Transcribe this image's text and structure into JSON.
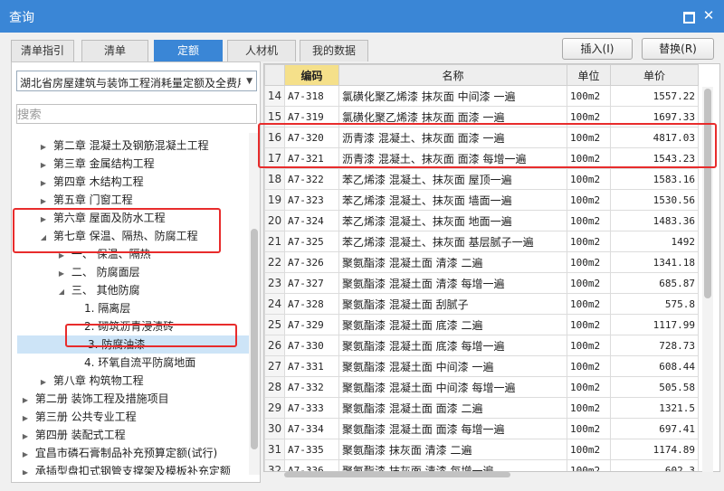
{
  "window": {
    "title": "查询"
  },
  "tabs": [
    {
      "label": "清单指引"
    },
    {
      "label": "清单"
    },
    {
      "label": "定额"
    },
    {
      "label": "人材机"
    },
    {
      "label": "我的数据"
    }
  ],
  "toolbar": {
    "insert_label": "插入(I)",
    "replace_label": "替换(R)"
  },
  "left": {
    "dropdown_value": "湖北省房屋建筑与装饰工程消耗量定额及全费用",
    "search_placeholder": "搜索",
    "tree": [
      {
        "label": "第二章 混凝土及钢筋混凝土工程",
        "expander": "▶"
      },
      {
        "label": "第三章 金属结构工程",
        "expander": "▶"
      },
      {
        "label": "第四章 木结构工程",
        "expander": "▶"
      },
      {
        "label": "第五章 门窗工程",
        "expander": "▶"
      },
      {
        "label": "第六章 屋面及防水工程",
        "expander": "▶"
      },
      {
        "label": "第七章 保温、隔热、防腐工程",
        "expander": "◢"
      },
      {
        "label": "一、 保温、隔热",
        "expander": "▶"
      },
      {
        "label": "二、 防腐面层",
        "expander": "▶"
      },
      {
        "label": "三、 其他防腐",
        "expander": "◢"
      },
      {
        "label": "1. 隔离层",
        "expander": ""
      },
      {
        "label": "2. 砌筑沥青浸渍砖",
        "expander": ""
      },
      {
        "label": "3. 防腐油漆",
        "expander": ""
      },
      {
        "label": "4. 环氧自流平防腐地面",
        "expander": ""
      },
      {
        "label": "第八章 构筑物工程",
        "expander": "▶"
      },
      {
        "label": "第二册 装饰工程及措施项目",
        "expander": "▶"
      },
      {
        "label": "第三册 公共专业工程",
        "expander": "▶"
      },
      {
        "label": "第四册 装配式工程",
        "expander": "▶"
      },
      {
        "label": "宜昌市磷石膏制品补充预算定额(试行)",
        "expander": "▶"
      },
      {
        "label": "承插型盘扣式钢管支撑架及模板补充定额",
        "expander": "▶"
      }
    ]
  },
  "grid": {
    "headers": {
      "idx": "",
      "code": "编码",
      "name": "名称",
      "unit": "单位",
      "price": "单价"
    },
    "rows": [
      {
        "idx": "14",
        "code": "A7-318",
        "name": "氯磺化聚乙烯漆 抹灰面 中间漆 一遍",
        "unit": "100m2",
        "price": "1557.22"
      },
      {
        "idx": "15",
        "code": "A7-319",
        "name": "氯磺化聚乙烯漆 抹灰面 面漆 一遍",
        "unit": "100m2",
        "price": "1697.33"
      },
      {
        "idx": "16",
        "code": "A7-320",
        "name": "沥青漆 混凝土、抹灰面 面漆 一遍",
        "unit": "100m2",
        "price": "4817.03"
      },
      {
        "idx": "17",
        "code": "A7-321",
        "name": "沥青漆 混凝土、抹灰面 面漆 每增一遍",
        "unit": "100m2",
        "price": "1543.23"
      },
      {
        "idx": "18",
        "code": "A7-322",
        "name": "苯乙烯漆 混凝土、抹灰面 屋顶一遍",
        "unit": "100m2",
        "price": "1583.16"
      },
      {
        "idx": "19",
        "code": "A7-323",
        "name": "苯乙烯漆 混凝土、抹灰面 墙面一遍",
        "unit": "100m2",
        "price": "1530.56"
      },
      {
        "idx": "20",
        "code": "A7-324",
        "name": "苯乙烯漆 混凝土、抹灰面 地面一遍",
        "unit": "100m2",
        "price": "1483.36"
      },
      {
        "idx": "21",
        "code": "A7-325",
        "name": "苯乙烯漆 混凝土、抹灰面 基层腻子一遍",
        "unit": "100m2",
        "price": "1492"
      },
      {
        "idx": "22",
        "code": "A7-326",
        "name": "聚氨酯漆 混凝土面 清漆 二遍",
        "unit": "100m2",
        "price": "1341.18"
      },
      {
        "idx": "23",
        "code": "A7-327",
        "name": "聚氨酯漆 混凝土面 清漆 每增一遍",
        "unit": "100m2",
        "price": "685.87"
      },
      {
        "idx": "24",
        "code": "A7-328",
        "name": "聚氨酯漆 混凝土面 刮腻子",
        "unit": "100m2",
        "price": "575.8"
      },
      {
        "idx": "25",
        "code": "A7-329",
        "name": "聚氨酯漆 混凝土面 底漆 二遍",
        "unit": "100m2",
        "price": "1117.99"
      },
      {
        "idx": "26",
        "code": "A7-330",
        "name": "聚氨酯漆 混凝土面 底漆 每增一遍",
        "unit": "100m2",
        "price": "728.73"
      },
      {
        "idx": "27",
        "code": "A7-331",
        "name": "聚氨酯漆 混凝土面 中间漆 一遍",
        "unit": "100m2",
        "price": "608.44"
      },
      {
        "idx": "28",
        "code": "A7-332",
        "name": "聚氨酯漆 混凝土面 中间漆 每增一遍",
        "unit": "100m2",
        "price": "505.58"
      },
      {
        "idx": "29",
        "code": "A7-333",
        "name": "聚氨酯漆 混凝土面 面漆 二遍",
        "unit": "100m2",
        "price": "1321.5"
      },
      {
        "idx": "30",
        "code": "A7-334",
        "name": "聚氨酯漆 混凝土面 面漆 每增一遍",
        "unit": "100m2",
        "price": "697.41"
      },
      {
        "idx": "31",
        "code": "A7-335",
        "name": "聚氨酯漆 抹灰面 清漆 二遍",
        "unit": "100m2",
        "price": "1174.89"
      },
      {
        "idx": "32",
        "code": "A7-336",
        "name": "聚氨酯漆 抹灰面 清漆 每增一遍",
        "unit": "100m2",
        "price": "602.3"
      }
    ]
  },
  "colors": {
    "titlebar": "#3a86d6",
    "active_tab": "#3a86d6",
    "header_highlight": "#f5e08a",
    "annotation_red": "#e82c2c",
    "selected_row": "#cde4f7"
  }
}
